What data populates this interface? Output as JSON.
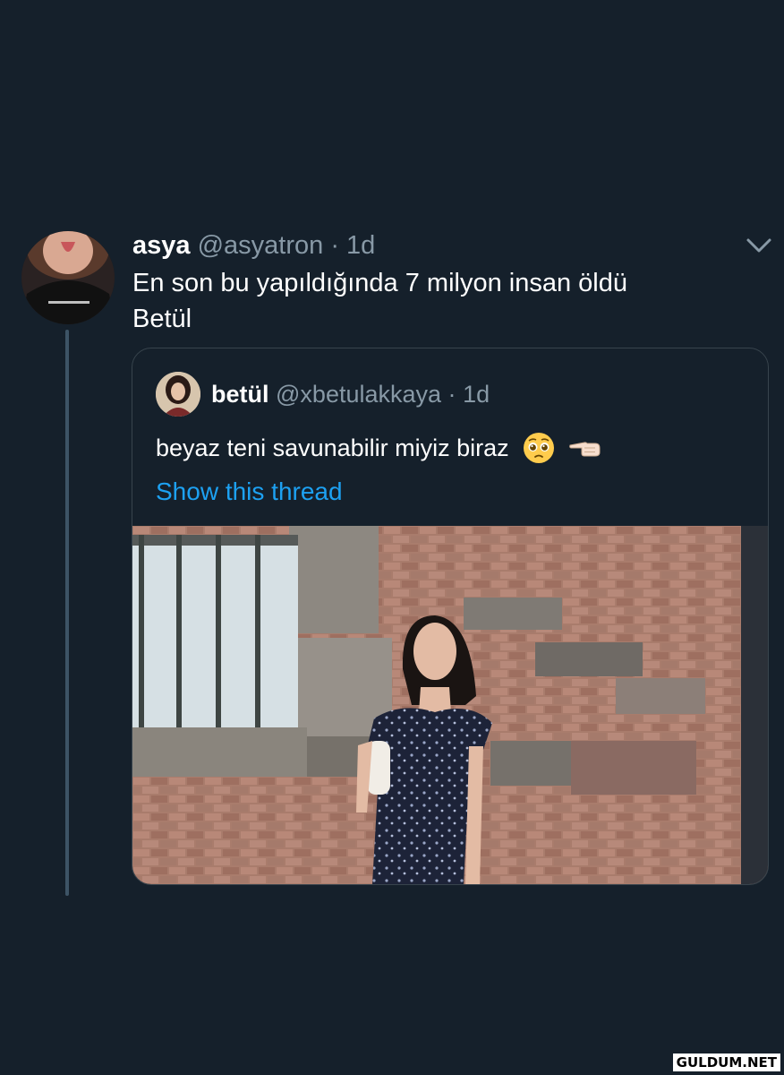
{
  "tweet": {
    "display_name": "asya",
    "handle": "@asyatron",
    "separator": "·",
    "time": "1d",
    "text_lines": [
      "En son bu yapıldığında 7 milyon insan öldü",
      "Betül"
    ],
    "menu_icon": "chevron-down-icon",
    "avatar_icon": "profile-photo"
  },
  "quote": {
    "display_name": "betül",
    "handle": "@xbetulakkaya",
    "separator": "·",
    "time": "1d",
    "text": "beyaz teni savunabilir miyiz biraz",
    "emojis": [
      "pleading-face-emoji",
      "pointing-left-emoji"
    ],
    "link_label": "Show this thread",
    "media": "photo-woman-brick-wall"
  },
  "watermark": "GULDUM.NET",
  "colors": {
    "background": "#15202b",
    "border": "#38444d",
    "secondary_text": "#8899a6",
    "link": "#1da1f2",
    "thread_line": "#3d5466"
  }
}
